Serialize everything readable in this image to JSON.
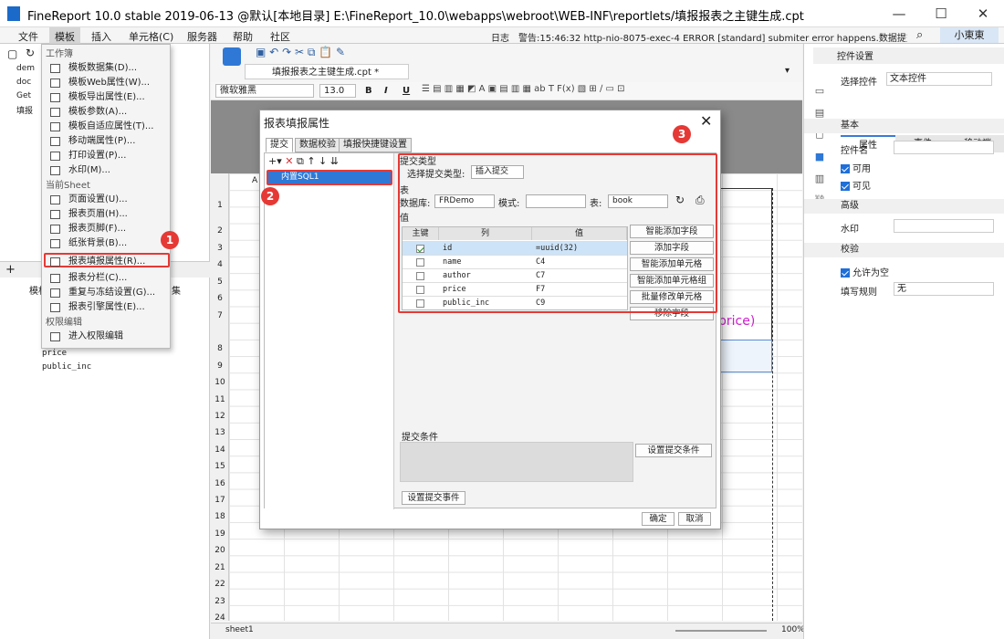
{
  "window": {
    "title": "FineReport 10.0 stable 2019-06-13 @默认[本地目录]    E:\\FineReport_10.0\\webapps\\webroot\\WEB-INF\\reportlets/填报报表之主键生成.cpt"
  },
  "menubar": {
    "items": [
      "文件",
      "模板",
      "插入",
      "单元格(C)",
      "服务器",
      "帮助",
      "社区"
    ],
    "log_label": "日志",
    "log_text": "警告:15:46:32 http-nio-8075-exec-4 ERROR [standard] submiter error happens.数据提交出错Fin...",
    "user": "小東東"
  },
  "template_menu": {
    "section_workbook": "工作簿",
    "workbook_items": [
      "模板数据集(D)...",
      "模板Web属性(W)...",
      "模板导出属性(E)...",
      "模板参数(A)...",
      "模板自适应属性(T)...",
      "移动端属性(P)...",
      "打印设置(P)...",
      "水印(M)..."
    ],
    "section_sheet": "当前Sheet",
    "sheet_items": [
      "页面设置(U)...",
      "报表页眉(H)...",
      "报表页脚(F)...",
      "纸张背景(B)...",
      "报表填报属性(R)...",
      "报表分栏(C)...",
      "重复与冻结设置(G)...",
      "报表引擎属性(E)..."
    ],
    "section_perm": "权限编辑",
    "perm_items": [
      "进入权限编辑"
    ]
  },
  "left_tree": {
    "items": [
      "dem",
      "doc",
      "Get",
      "填报"
    ],
    "fields": [
      "price",
      "public_inc"
    ],
    "partial_label": "模板",
    "partial_label2": "集"
  },
  "editor": {
    "tab": "填报报表之主键生成.cpt *",
    "font": "微软雅黑",
    "size": "13.0",
    "toolbar_labels": [
      "B",
      "I",
      "U"
    ],
    "col_a": "A",
    "rows": [
      "1",
      "2",
      "3",
      "4",
      "5",
      "6",
      "7",
      "8",
      "9",
      "10",
      "11",
      "12",
      "13",
      "14",
      "15",
      "16",
      "17",
      "18",
      "19",
      "20",
      "21",
      "22",
      "23",
      "24"
    ],
    "cell_fragment": "price)",
    "sheet": "sheet1",
    "zoom": "100%"
  },
  "right_panel": {
    "title": "控件设置",
    "select_label": "选择控件",
    "select_value": "文本控件",
    "tabs": [
      "属性",
      "事件",
      "移动端"
    ],
    "sec_basic": "基本",
    "field_name": "控件名",
    "enabled": "可用",
    "visible": "可见",
    "sec_advanced": "高级",
    "watermark": "水印",
    "sec_validate": "校验",
    "allow_empty": "允许为空",
    "rule_label": "填写规则",
    "rule_value": "无"
  },
  "dialog": {
    "title": "报表填报属性",
    "tabs": [
      "提交",
      "数据校验",
      "填报快捷键设置"
    ],
    "list_item": "内置SQL1",
    "submit_type_section": "提交类型",
    "submit_type_label": "选择提交类型:",
    "submit_type_value": "插入提交",
    "table_section": "表",
    "db_label": "数据库:",
    "db_value": "FRDemo",
    "schema_label": "模式:",
    "table_label": "表:",
    "table_value": "book",
    "value_section": "值",
    "columns": [
      "主键",
      "列",
      "值"
    ],
    "rows": [
      {
        "key": true,
        "col": "id",
        "val": "=uuid(32)"
      },
      {
        "key": false,
        "col": "name",
        "val": "C4"
      },
      {
        "key": false,
        "col": "author",
        "val": "C7"
      },
      {
        "key": false,
        "col": "price",
        "val": "F7"
      },
      {
        "key": false,
        "col": "public_inc",
        "val": "C9"
      }
    ],
    "side_buttons": [
      "智能添加字段",
      "添加字段",
      "智能添加单元格",
      "智能添加单元格组",
      "批量修改单元格",
      "移除字段"
    ],
    "condition_section": "提交条件",
    "condition_button": "设置提交条件",
    "event_button": "设置提交事件",
    "ok": "确定",
    "cancel": "取消"
  },
  "callouts": [
    "1",
    "2",
    "3"
  ],
  "colors": {
    "accent": "#2f78d5",
    "callout": "#e53935"
  }
}
